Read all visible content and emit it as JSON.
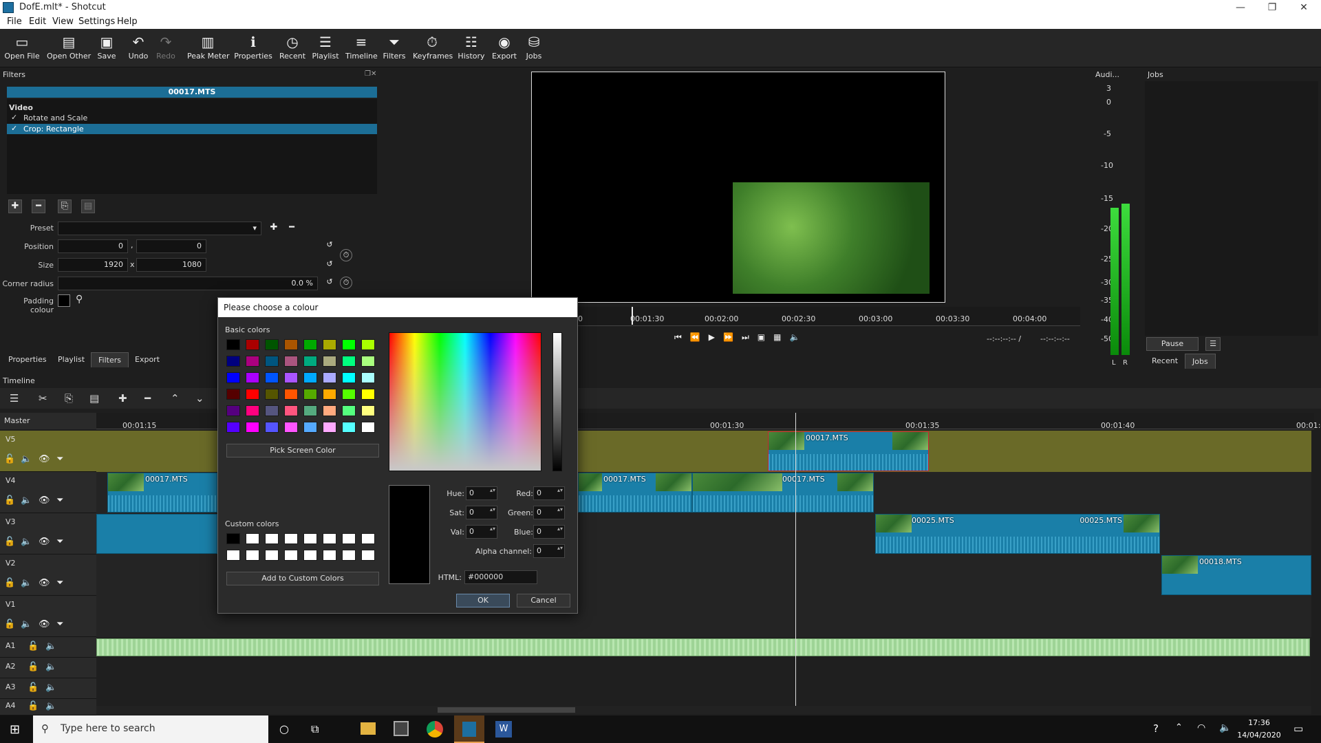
{
  "window": {
    "title": "DofE.mlt* - Shotcut"
  },
  "menu": [
    "File",
    "Edit",
    "View",
    "Settings",
    "Help"
  ],
  "toolbar": [
    {
      "label": "Open File",
      "icon": "open-file-icon"
    },
    {
      "label": "Open Other",
      "icon": "open-other-icon"
    },
    {
      "label": "Save",
      "icon": "save-icon"
    },
    {
      "label": "Undo",
      "icon": "undo-icon"
    },
    {
      "label": "Redo",
      "icon": "redo-icon"
    },
    {
      "label": "Peak Meter",
      "icon": "peak-meter-icon"
    },
    {
      "label": "Properties",
      "icon": "properties-icon"
    },
    {
      "label": "Recent",
      "icon": "recent-icon"
    },
    {
      "label": "Playlist",
      "icon": "playlist-icon"
    },
    {
      "label": "Timeline",
      "icon": "timeline-icon"
    },
    {
      "label": "Filters",
      "icon": "filters-icon"
    },
    {
      "label": "Keyframes",
      "icon": "keyframes-icon"
    },
    {
      "label": "History",
      "icon": "history-icon"
    },
    {
      "label": "Export",
      "icon": "export-icon"
    },
    {
      "label": "Jobs",
      "icon": "jobs-icon"
    }
  ],
  "filters": {
    "panel_title": "Filters",
    "clip_name": "00017.MTS",
    "section": "Video",
    "items": [
      "Rotate and Scale",
      "Crop: Rectangle"
    ],
    "preset_label": "Preset",
    "position_label": "Position",
    "position_x": "0",
    "position_y": "0",
    "size_label": "Size",
    "size_w": "1920",
    "size_h": "1080",
    "size_x": "x",
    "comma": ",",
    "corner_label": "Corner radius",
    "corner_value": "0.0 %",
    "padding_label": "Padding colour"
  },
  "tabs": [
    "Properties",
    "Playlist",
    "Filters",
    "Export"
  ],
  "player": {
    "ruler": [
      "0",
      "00:01:30",
      "00:02:00",
      "00:02:30",
      "00:03:00",
      "00:03:30",
      "00:04:00"
    ],
    "timecode_a": "--:--:--:-- /",
    "timecode_b": "--:--:--:--"
  },
  "audio": {
    "title": "Audi...",
    "scale": [
      "3",
      "0",
      "-5",
      "-10",
      "-15",
      "-20",
      "-25",
      "-30",
      "-35",
      "-40",
      "-50"
    ],
    "l": "L",
    "r": "R"
  },
  "jobs": {
    "title": "Jobs",
    "pause": "Pause",
    "recent_tab": "Recent",
    "jobs_tab": "Jobs"
  },
  "timeline": {
    "title": "Timeline",
    "master": "Master",
    "ticks": [
      "00:01:15",
      "00:01:30",
      "00:01:35",
      "00:01:40",
      "00:01:4"
    ],
    "tracks": [
      "V5",
      "V4",
      "V3",
      "V2",
      "V1",
      "A1",
      "A2",
      "A3",
      "A4"
    ],
    "clips": [
      "00017.MTS",
      "00017.MTS",
      "00017.MTS",
      "00017.MTS",
      "00025.MTS",
      "00025.MTS",
      "00018.MTS"
    ]
  },
  "dialog": {
    "title": "Please choose a colour",
    "basic_colors_label": "Basic colors",
    "pick_screen": "Pick Screen Color",
    "custom_colors_label": "Custom colors",
    "add_custom": "Add to Custom Colors",
    "hue_label": "Hue:",
    "hue": "0",
    "sat_label": "Sat:",
    "sat": "0",
    "val_label": "Val:",
    "val": "0",
    "red_label": "Red:",
    "red": "0",
    "green_label": "Green:",
    "green": "0",
    "blue_label": "Blue:",
    "blue": "0",
    "alpha_label": "Alpha channel:",
    "alpha": "0",
    "html_label": "HTML:",
    "html": "#000000",
    "ok": "OK",
    "cancel": "Cancel",
    "basic_colors": [
      "#000000",
      "#aa0000",
      "#005500",
      "#aa5500",
      "#00aa00",
      "#aaaa00",
      "#00ff00",
      "#aaff00",
      "#00007f",
      "#aa007f",
      "#00557f",
      "#aa557f",
      "#00aa7f",
      "#aaaa7f",
      "#00ff7f",
      "#aaff7f",
      "#0000ff",
      "#aa00ff",
      "#0055ff",
      "#aa55ff",
      "#00aaff",
      "#aaaaff",
      "#00ffff",
      "#aaffff",
      "#550000",
      "#ff0000",
      "#555500",
      "#ff5500",
      "#55aa00",
      "#ffaa00",
      "#55ff00",
      "#ffff00",
      "#55007f",
      "#ff007f",
      "#55557f",
      "#ff557f",
      "#55aa7f",
      "#ffaa7f",
      "#55ff7f",
      "#ffff7f",
      "#5500ff",
      "#ff00ff",
      "#5555ff",
      "#ff55ff",
      "#55aaff",
      "#ffaaff",
      "#55ffff",
      "#ffffff"
    ]
  },
  "taskbar": {
    "search_placeholder": "Type here to search",
    "time": "17:36",
    "date": "14/04/2020"
  }
}
